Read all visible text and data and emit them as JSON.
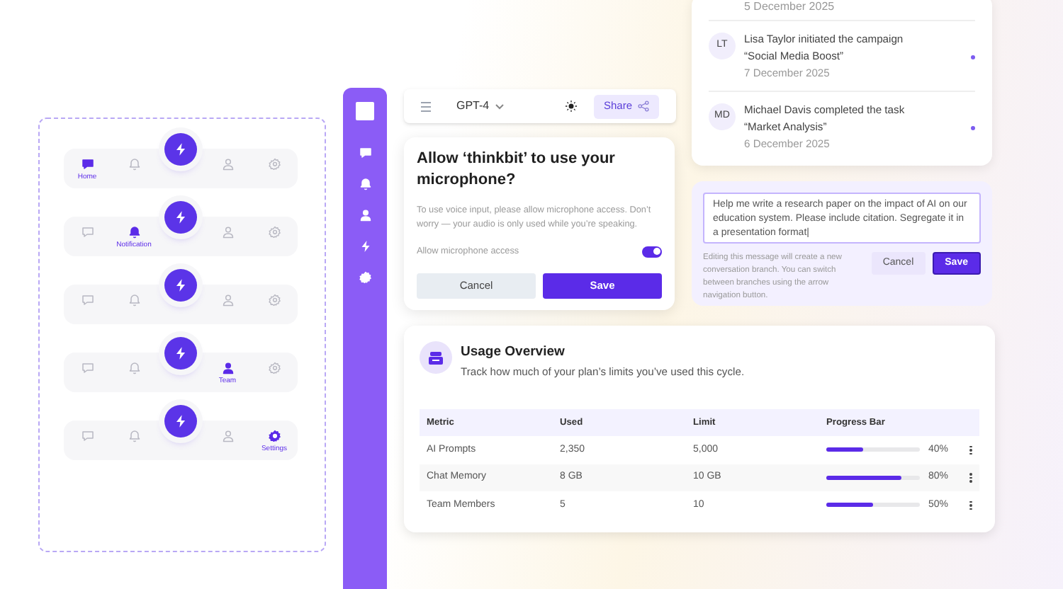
{
  "nav_bars": [
    {
      "items": [
        {
          "kind": "chat",
          "selected": true,
          "label": "Home"
        },
        {
          "kind": "bell",
          "selected": false
        },
        {
          "kind": "user",
          "selected": false
        },
        {
          "kind": "gear",
          "selected": false
        }
      ]
    },
    {
      "items": [
        {
          "kind": "chat",
          "selected": false
        },
        {
          "kind": "bell",
          "selected": true,
          "label": "Notification"
        },
        {
          "kind": "user",
          "selected": false
        },
        {
          "kind": "gear",
          "selected": false
        }
      ]
    },
    {
      "items": [
        {
          "kind": "chat",
          "selected": false
        },
        {
          "kind": "bell",
          "selected": false
        },
        {
          "kind": "user",
          "selected": false
        },
        {
          "kind": "gear",
          "selected": false
        }
      ]
    },
    {
      "items": [
        {
          "kind": "chat",
          "selected": false
        },
        {
          "kind": "bell",
          "selected": false
        },
        {
          "kind": "user",
          "selected": true,
          "label": "Team"
        },
        {
          "kind": "gear",
          "selected": false
        }
      ]
    },
    {
      "items": [
        {
          "kind": "chat",
          "selected": false
        },
        {
          "kind": "bell",
          "selected": false
        },
        {
          "kind": "user",
          "selected": false
        },
        {
          "kind": "gear",
          "selected": true,
          "label": "Settings"
        }
      ]
    }
  ],
  "sidebar": {
    "items": [
      {
        "kind": "chat"
      },
      {
        "kind": "bell"
      },
      {
        "kind": "user"
      },
      {
        "kind": "bolt"
      },
      {
        "kind": "gear"
      }
    ]
  },
  "header": {
    "model": "GPT-4",
    "share": "Share"
  },
  "dialog": {
    "title": "Allow ‘thinkbit’ to use your microphone?",
    "body": "To use voice input, please allow microphone access. Don’t worry — your audio is only used while you’re speaking.",
    "toggle_label": "Allow microphone access",
    "toggle_on": true,
    "cancel": "Cancel",
    "save": "Save"
  },
  "activity": {
    "partial_date": "5 December 2025",
    "items": [
      {
        "initials": "LT",
        "text": "Lisa Taylor initiated the campaign “Social Media Boost”",
        "date": "7 December 2025",
        "unread": true
      },
      {
        "initials": "MD",
        "text": "Michael Davis completed the task “Market Analysis”",
        "date": "6 December 2025",
        "unread": true
      }
    ]
  },
  "edit": {
    "value": "Help me write a research paper on the impact of AI on our education system. Please include citation. Segregate it in a presentation format|",
    "note": "Editing this message will create a new conversation branch. You can switch between branches using the arrow navigation button.",
    "cancel": "Cancel",
    "save": "Save"
  },
  "usage": {
    "title": "Usage Overview",
    "subtitle": "Track how much of your plan’s limits you’ve used this cycle.",
    "columns": [
      "Metric",
      "Used",
      "Limit",
      "Progress Bar"
    ],
    "rows": [
      {
        "metric": "AI Prompts",
        "used": "2,350",
        "limit": "5,000",
        "level": 0.4,
        "percent": "40%"
      },
      {
        "metric": "Chat Memory",
        "used": "8 GB",
        "limit": "10 GB",
        "level": 0.8,
        "percent": "80%"
      },
      {
        "metric": "Team Members",
        "used": "5",
        "limit": "10",
        "level": 0.5,
        "percent": "50%"
      }
    ]
  }
}
